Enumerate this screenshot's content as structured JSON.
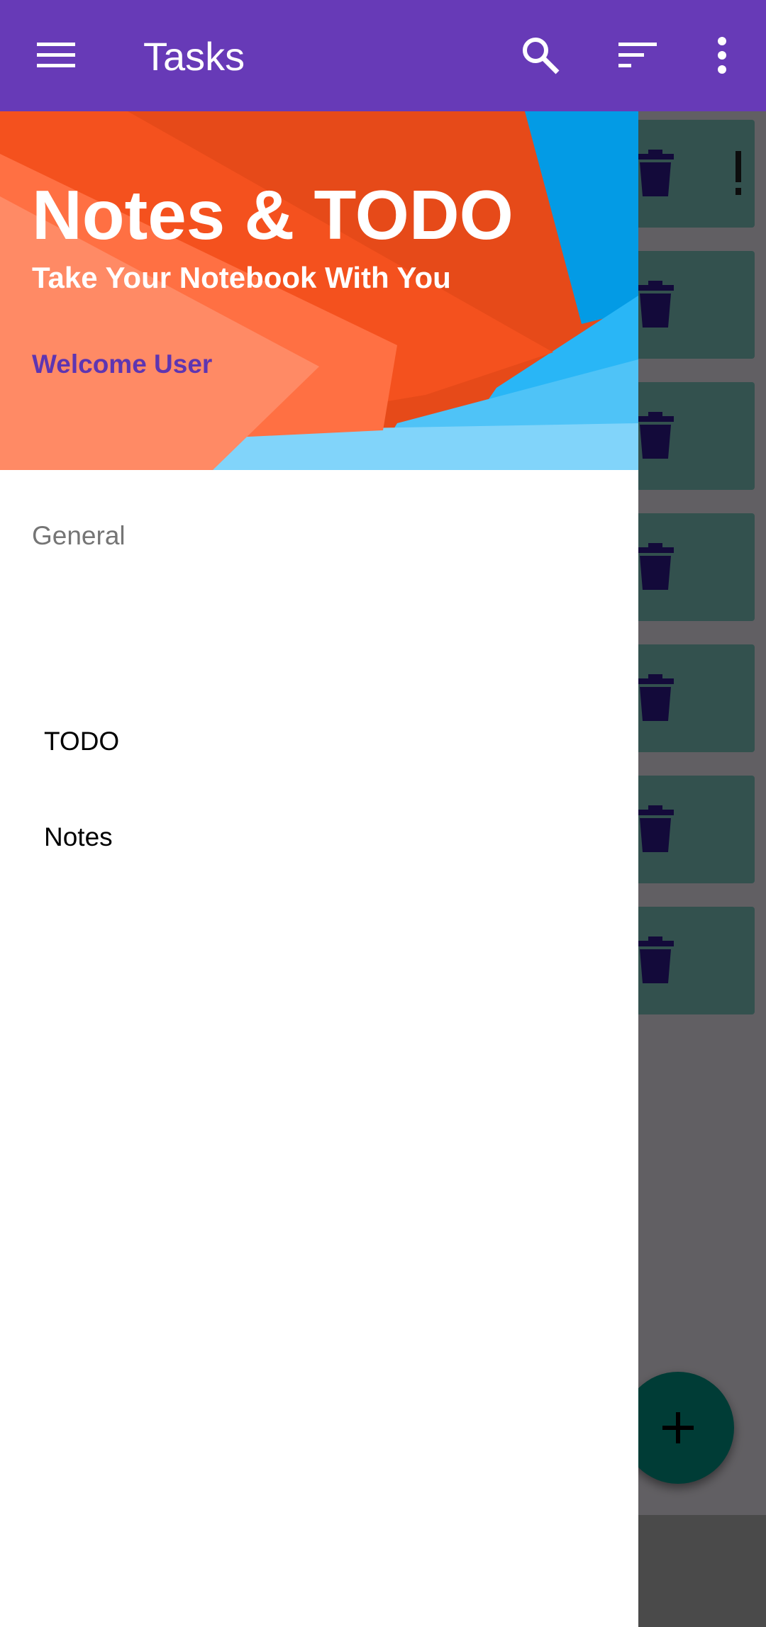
{
  "app_bar": {
    "title": "Tasks",
    "icons": [
      "menu-icon",
      "search-icon",
      "sort-icon",
      "more-vert-icon"
    ]
  },
  "drawer": {
    "header": {
      "title": "Notes & TODO",
      "subtitle": "Take Your Notebook With You",
      "welcome": "Welcome User"
    },
    "section_label": "General",
    "items": [
      {
        "label": "TODO"
      },
      {
        "label": "Notes"
      }
    ]
  },
  "task_list": {
    "card_count_visible": 7,
    "icons": [
      "trash-icon",
      "priority-icon"
    ]
  },
  "fab": {
    "icon": "add-icon"
  },
  "colors": {
    "primary": "#673ab7",
    "accent": "#009688",
    "card": "#80cbc4",
    "welcome_text": "#5e35b1"
  }
}
